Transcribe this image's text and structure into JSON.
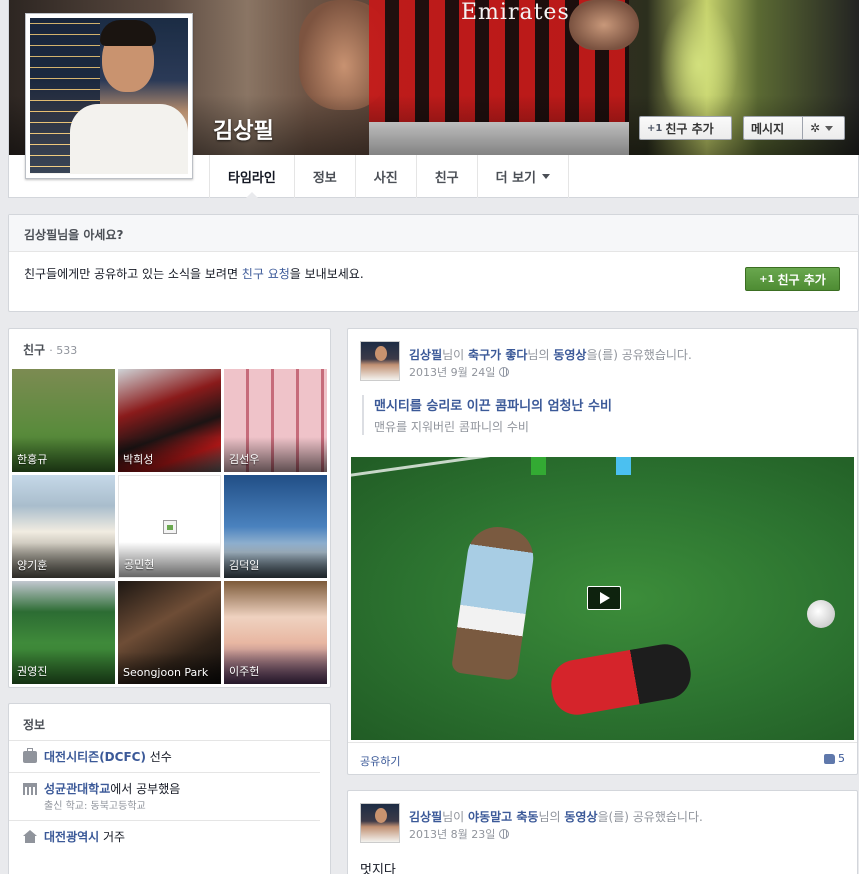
{
  "header": {
    "cover_sponsor": "Emirates",
    "name": "김상필",
    "add_friend": "친구 추가",
    "add_friend_icon": "+1",
    "message": "메시지",
    "gear_icon": "gear-icon",
    "tabs": [
      {
        "label": "타임라인",
        "active": true
      },
      {
        "label": "정보"
      },
      {
        "label": "사진"
      },
      {
        "label": "친구"
      },
      {
        "label": "더 보기",
        "caret": true
      }
    ]
  },
  "know_card": {
    "title": "김상필님을 아세요?",
    "text": "친구들에게만 공유하고 있는 소식을 보려면 ",
    "link": "친구 요청",
    "text_after": "을 보내보세요.",
    "button": "친구 추가",
    "button_icon": "+1"
  },
  "friends": {
    "title": "친구",
    "count": "· 533",
    "items": [
      {
        "name": "한홍규"
      },
      {
        "name": "박희성"
      },
      {
        "name": "김선우"
      },
      {
        "name": "양기훈"
      },
      {
        "name": "공민현"
      },
      {
        "name": "김덕일"
      },
      {
        "name": "권영진"
      },
      {
        "name": "Seongjoon Park"
      },
      {
        "name": "이주헌"
      }
    ]
  },
  "info": {
    "title": "정보",
    "rows": [
      {
        "icon": "briefcase-icon",
        "link": "대전시티즌(DCFC)",
        "plain": " 선수"
      },
      {
        "icon": "school-icon",
        "link": "성균관대학교",
        "plain": "에서 공부했음",
        "sub": "출신 학교: 동북고등학교"
      },
      {
        "icon": "home-icon",
        "link": "대전광역시",
        "plain": " 거주"
      }
    ]
  },
  "posts": [
    {
      "author": "김상필",
      "mid1": "님이 ",
      "page": "축구가 좋다",
      "mid2": "님의 ",
      "object": "동영상",
      "tail": "을(를) 공유했습니다.",
      "date": "2013년 9월 24일",
      "link_title": "맨시티를 승리로 이끈 콤파니의 엄청난 수비",
      "link_desc": "맨유를 지워버린 콤파니의 수비",
      "share": "공유하기",
      "likes": "5"
    },
    {
      "author": "김상필",
      "mid1": "님이 ",
      "page": "야동말고 축동",
      "mid2": "님의 ",
      "object": "동영상",
      "tail": "을(를) 공유했습니다.",
      "date": "2013년 8월 23일",
      "body": "멋지다"
    }
  ]
}
